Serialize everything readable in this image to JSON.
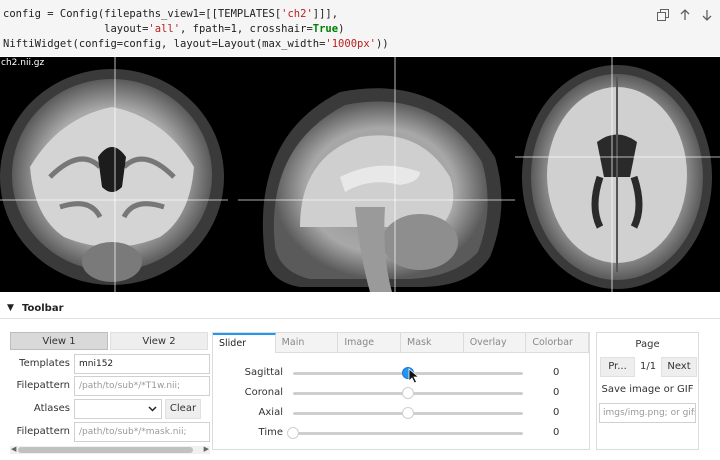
{
  "code": {
    "line1": {
      "pre": "config = Config(filepaths_view1=[[TEMPLATES[",
      "str": "'ch2'",
      "post": "]]],"
    },
    "line2": {
      "pre": "                layout=",
      "str": "'all'",
      "mid": ", fpath=1, crosshair=",
      "kw": "True",
      "post": ")"
    },
    "line3": {
      "pre": "NiftiWidget(config=config, layout=Layout(max_width=",
      "str": "'1000px'",
      "post": "))"
    }
  },
  "viewer": {
    "filename": "ch2.nii.gz"
  },
  "toolbar": {
    "title": "Toolbar"
  },
  "left_panel": {
    "tabs": [
      "View 1",
      "View 2"
    ],
    "templates_label": "Templates",
    "templates_value": "mni152",
    "filepattern_label": "Filepattern",
    "filepattern_placeholder": "/path/to/sub*/*T1w.nii;",
    "atlases_label": "Atlases",
    "clear_label": "Clear",
    "filepattern2_label": "Filepattern",
    "filepattern2_placeholder": "/path/to/sub*/*mask.nii;"
  },
  "mid_panel": {
    "tabs": [
      "Slider",
      "Main",
      "Image",
      "Mask",
      "Overlay",
      "Colorbar"
    ],
    "sliders": [
      {
        "label": "Sagittal",
        "value": "0",
        "level": 0.5,
        "active": true
      },
      {
        "label": "Coronal",
        "value": "0",
        "level": 0.5,
        "active": false
      },
      {
        "label": "Axial",
        "value": "0",
        "level": 0.5,
        "active": false
      },
      {
        "label": "Time",
        "value": "0",
        "level": 0.0,
        "active": false
      }
    ]
  },
  "right_panel": {
    "page_label": "Page",
    "prev_label": "Pr...",
    "page_count": "1/1",
    "next_label": "Next",
    "save_label": "Save image or GIF",
    "save_placeholder": "imgs/img.png; or gifs"
  },
  "colors": {
    "accent": "#2196f3",
    "tab_active_bg": "#d9d9d9",
    "viewer_bg": "#000000"
  }
}
